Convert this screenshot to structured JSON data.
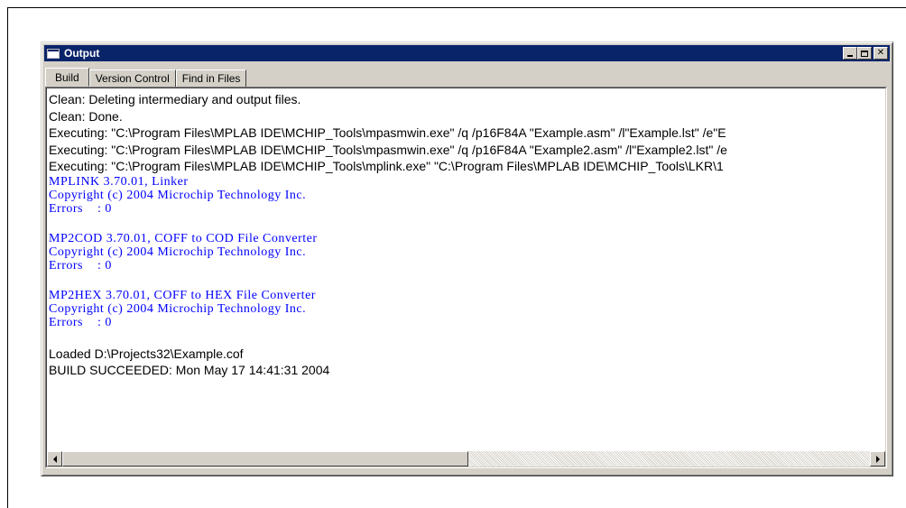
{
  "window": {
    "title": "Output",
    "icon": "window-icon",
    "caption_buttons": [
      "minimize",
      "maximize",
      "close"
    ]
  },
  "tabs": [
    {
      "label": "Build",
      "active": true
    },
    {
      "label": "Version Control",
      "active": false
    },
    {
      "label": "Find in Files",
      "active": false
    }
  ],
  "output_lines": [
    {
      "text": "Clean: Deleting intermediary and output files.",
      "style": "sans"
    },
    {
      "text": "Clean: Done.",
      "style": "sans"
    },
    {
      "text": "Executing: \"C:\\Program Files\\MPLAB IDE\\MCHIP_Tools\\mpasmwin.exe\" /q /p16F84A \"Example.asm\" /l\"Example.lst\" /e\"E",
      "style": "sans"
    },
    {
      "text": "Executing: \"C:\\Program Files\\MPLAB IDE\\MCHIP_Tools\\mpasmwin.exe\" /q /p16F84A \"Example2.asm\" /l\"Example2.lst\" /e",
      "style": "sans"
    },
    {
      "text": "Executing: \"C:\\Program Files\\MPLAB IDE\\MCHIP_Tools\\mplink.exe\" \"C:\\Program Files\\MPLAB IDE\\MCHIP_Tools\\LKR\\1",
      "style": "sans"
    },
    {
      "text": "MPLINK 3.70.01, Linker",
      "style": "mono"
    },
    {
      "text": "Copyright (c) 2004 Microchip Technology Inc.",
      "style": "mono"
    },
    {
      "text": "Errors    : 0",
      "style": "mono"
    },
    {
      "text": "",
      "style": "blank"
    },
    {
      "text": "MP2COD 3.70.01, COFF to COD File Converter",
      "style": "mono"
    },
    {
      "text": "Copyright (c) 2004 Microchip Technology Inc.",
      "style": "mono"
    },
    {
      "text": "Errors    : 0",
      "style": "mono"
    },
    {
      "text": "",
      "style": "blank"
    },
    {
      "text": "MP2HEX 3.70.01, COFF to HEX File Converter",
      "style": "mono"
    },
    {
      "text": "Copyright (c) 2004 Microchip Technology Inc.",
      "style": "mono"
    },
    {
      "text": "Errors    : 0",
      "style": "mono"
    },
    {
      "text": "",
      "style": "blank"
    },
    {
      "text": "Loaded D:\\Projects32\\Example.cof",
      "style": "sans"
    },
    {
      "text": "BUILD SUCCEEDED: Mon May 17 14:41:31 2004",
      "style": "sans"
    }
  ],
  "colors": {
    "titlebar": "#0a246a",
    "linker_output": "#0000ff",
    "window_face": "#d4d0c8"
  }
}
